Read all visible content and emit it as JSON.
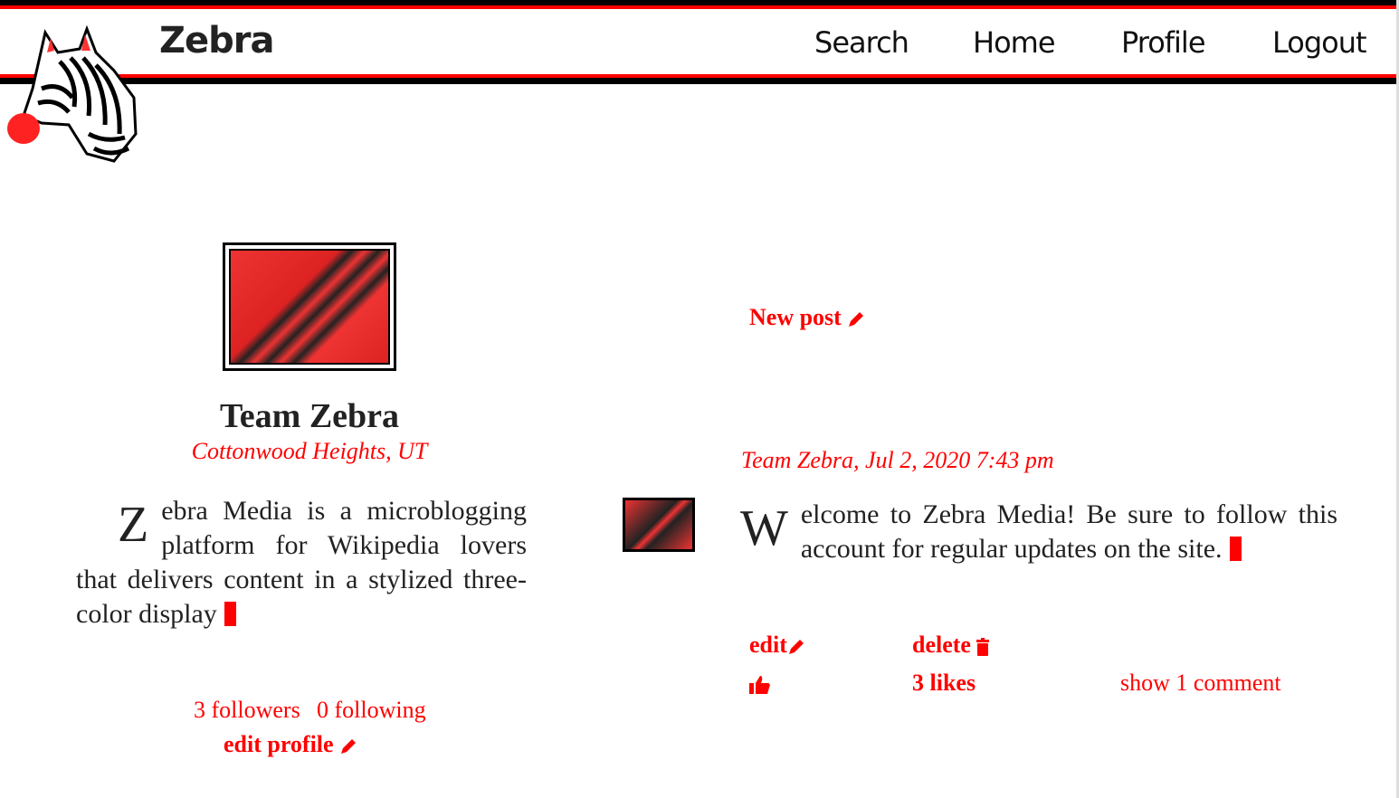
{
  "header": {
    "brand": "Zebra",
    "nav": [
      "Search",
      "Home",
      "Profile",
      "Logout"
    ]
  },
  "profile": {
    "name": "Team Zebra",
    "location": "Cottonwood Heights, UT",
    "bio_initial": "Z",
    "bio_rest": "ebra Media is a microblogging platform for Wikipedia lovers that delivers content in a stylized three-color display",
    "followers": "3 followers",
    "following": "0 following",
    "edit_profile": "edit profile"
  },
  "feed": {
    "new_post": "New post",
    "post": {
      "meta": "Team Zebra, Jul 2, 2020 7:43 pm",
      "initial": "W",
      "rest": "elcome to Zebra Media! Be sure to follow this account for regular updates on the site.",
      "edit": "edit",
      "delete": "delete",
      "likes": "3 likes",
      "comments": "show 1 comment"
    }
  },
  "colors": {
    "accent": "#ff0000",
    "dark": "#000000"
  }
}
